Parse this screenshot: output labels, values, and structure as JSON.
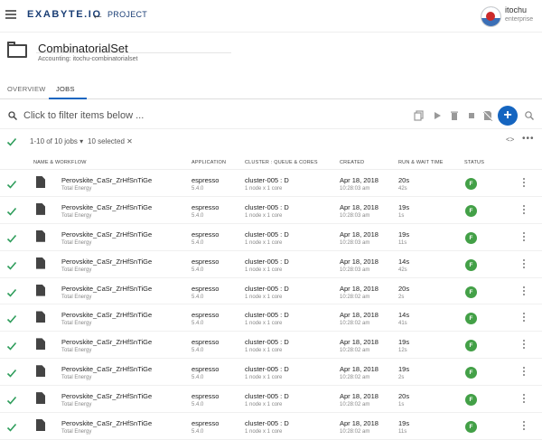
{
  "topbar": {
    "logo": "EXABYTE.IO",
    "project_label": "PROJECT",
    "user_name": "itochu",
    "user_org": "enterprise"
  },
  "header": {
    "title": "CombinatorialSet",
    "subtitle": "Accounting: itochu-combinatorialset"
  },
  "tabs": [
    {
      "label": "OVERVIEW",
      "active": false
    },
    {
      "label": "JOBS",
      "active": true
    }
  ],
  "filter": {
    "placeholder": "Click to filter items below ..."
  },
  "selection": {
    "range": "1-10 of 10 jobs ▾",
    "count": "10 selected ✕",
    "toggle": "<>",
    "more": "•••"
  },
  "columns": {
    "name": "NAME & WORKFLOW",
    "application": "APPLICATION",
    "cluster": "CLUSTER : QUEUE & CORES",
    "created": "CREATED",
    "run": "RUN & WAIT TIME",
    "status": "STATUS"
  },
  "colors": {
    "accent": "#1565c0",
    "check": "#2e9d5b",
    "status_finished": "#43a047"
  },
  "rows": [
    {
      "name": "Perovskite_CaSr_ZrHfSnTiGe",
      "workflow": "Total Energy",
      "app": "espresso",
      "app_version": "5.4.0",
      "cluster": "cluster-005 : D",
      "cores": "1 node x 1 core",
      "date": "Apr 18, 2018",
      "time": "10:28:03 am",
      "run": "20s",
      "wait": "42s",
      "status": "F"
    },
    {
      "name": "Perovskite_CaSr_ZrHfSnTiGe",
      "workflow": "Total Energy",
      "app": "espresso",
      "app_version": "5.4.0",
      "cluster": "cluster-005 : D",
      "cores": "1 node x 1 core",
      "date": "Apr 18, 2018",
      "time": "10:28:03 am",
      "run": "19s",
      "wait": "1s",
      "status": "F"
    },
    {
      "name": "Perovskite_CaSr_ZrHfSnTiGe",
      "workflow": "Total Energy",
      "app": "espresso",
      "app_version": "5.4.0",
      "cluster": "cluster-005 : D",
      "cores": "1 node x 1 core",
      "date": "Apr 18, 2018",
      "time": "10:28:03 am",
      "run": "19s",
      "wait": "11s",
      "status": "F"
    },
    {
      "name": "Perovskite_CaSr_ZrHfSnTiGe",
      "workflow": "Total Energy",
      "app": "espresso",
      "app_version": "5.4.0",
      "cluster": "cluster-005 : D",
      "cores": "1 node x 1 core",
      "date": "Apr 18, 2018",
      "time": "10:28:03 am",
      "run": "14s",
      "wait": "42s",
      "status": "F"
    },
    {
      "name": "Perovskite_CaSr_ZrHfSnTiGe",
      "workflow": "Total Energy",
      "app": "espresso",
      "app_version": "5.4.0",
      "cluster": "cluster-005 : D",
      "cores": "1 node x 1 core",
      "date": "Apr 18, 2018",
      "time": "10:28:02 am",
      "run": "20s",
      "wait": "2s",
      "status": "F"
    },
    {
      "name": "Perovskite_CaSr_ZrHfSnTiGe",
      "workflow": "Total Energy",
      "app": "espresso",
      "app_version": "5.4.0",
      "cluster": "cluster-005 : D",
      "cores": "1 node x 1 core",
      "date": "Apr 18, 2018",
      "time": "10:28:02 am",
      "run": "14s",
      "wait": "41s",
      "status": "F"
    },
    {
      "name": "Perovskite_CaSr_ZrHfSnTiGe",
      "workflow": "Total Energy",
      "app": "espresso",
      "app_version": "5.4.0",
      "cluster": "cluster-005 : D",
      "cores": "1 node x 1 core",
      "date": "Apr 18, 2018",
      "time": "10:28:02 am",
      "run": "19s",
      "wait": "12s",
      "status": "F"
    },
    {
      "name": "Perovskite_CaSr_ZrHfSnTiGe",
      "workflow": "Total Energy",
      "app": "espresso",
      "app_version": "5.4.0",
      "cluster": "cluster-005 : D",
      "cores": "1 node x 1 core",
      "date": "Apr 18, 2018",
      "time": "10:28:02 am",
      "run": "19s",
      "wait": "2s",
      "status": "F"
    },
    {
      "name": "Perovskite_CaSr_ZrHfSnTiGe",
      "workflow": "Total Energy",
      "app": "espresso",
      "app_version": "5.4.0",
      "cluster": "cluster-005 : D",
      "cores": "1 node x 1 core",
      "date": "Apr 18, 2018",
      "time": "10:28:02 am",
      "run": "20s",
      "wait": "1s",
      "status": "F"
    },
    {
      "name": "Perovskite_CaSr_ZrHfSnTiGe",
      "workflow": "Total Energy",
      "app": "espresso",
      "app_version": "5.4.0",
      "cluster": "cluster-005 : D",
      "cores": "1 node x 1 core",
      "date": "Apr 18, 2018",
      "time": "10:28:02 am",
      "run": "19s",
      "wait": "11s",
      "status": "F"
    }
  ]
}
